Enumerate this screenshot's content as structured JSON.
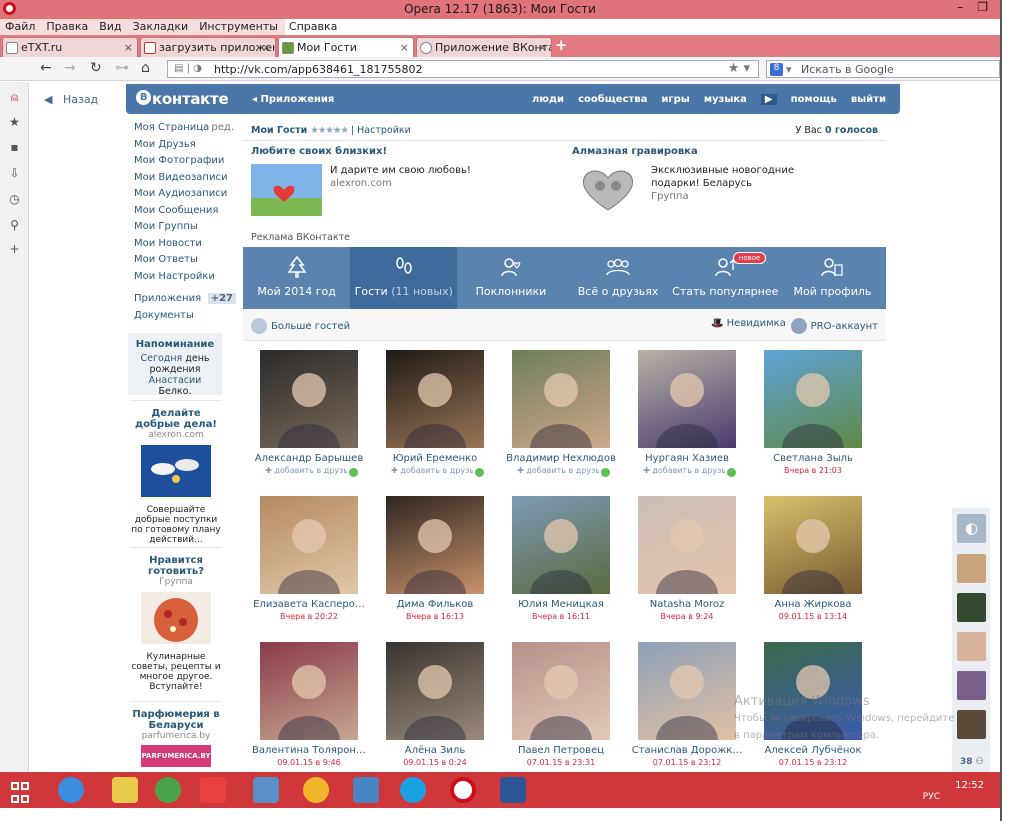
{
  "window": {
    "title": "Opera 12.17 (1863): Мои Гости",
    "menu": [
      "Файл",
      "Правка",
      "Вид",
      "Закладки",
      "Инструменты",
      "Справка"
    ],
    "tabs": [
      {
        "label": "eTXT.ru"
      },
      {
        "label": "загрузить приложени…"
      },
      {
        "label": "Мои Гости"
      },
      {
        "label": "Приложение ВКонтак…"
      }
    ],
    "url": "http://vk.com/app638461_181755802",
    "search_placeholder": "Искать в Google"
  },
  "vk": {
    "back": "Назад",
    "logo": "контакте",
    "apps_link": "Приложения",
    "nav": [
      "люди",
      "сообщества",
      "игры",
      "музыка",
      "помощь",
      "выйти"
    ],
    "left_menu": [
      {
        "label": "Моя Страница",
        "extra": "ред."
      },
      {
        "label": "Мои Друзья"
      },
      {
        "label": "Мои Фотографии"
      },
      {
        "label": "Мои Видеозаписи"
      },
      {
        "label": "Мои Аудиозаписи"
      },
      {
        "label": "Мои Сообщения"
      },
      {
        "label": "Мои Группы"
      },
      {
        "label": "Мои Новости"
      },
      {
        "label": "Мои Ответы"
      },
      {
        "label": "Мои Настройки"
      }
    ],
    "left_menu2": [
      {
        "label": "Приложения",
        "count": "+27"
      },
      {
        "label": "Документы"
      }
    ],
    "reminder": {
      "title": "Напоминание",
      "line1_link": "Сегодня",
      "line1_rest": "день",
      "line2": "рождения",
      "line2_link": "Анастасии",
      "line3": "Белко."
    },
    "side_ads": [
      {
        "title": "Делайте добрые дела!",
        "sub": "alexron.com",
        "text": "Совершайте добрые поступки по готовому плану действий..."
      },
      {
        "title": "Нравится готовить?",
        "sub": "Группа",
        "text": "Кулинарные советы, рецепты и многое другое. Вступайте!"
      },
      {
        "title": "Парфюмерия в Беларуси",
        "sub": "parfumerica.by",
        "text": "PARFUMERICA.BY"
      }
    ]
  },
  "app": {
    "name": "Мои Гости",
    "stars": "★★★★★",
    "settings": "Настройки",
    "votes_prefix": "У Вас",
    "votes_value": "0 голосов",
    "ads": [
      {
        "title": "Любите своих близких!",
        "text": "И дарите им свою любовь!",
        "domain": "alexron.com"
      },
      {
        "title": "Алмазная гравировка",
        "text": "Эксклюзивные новогодние подарки! Беларусь",
        "domain": "Группа"
      }
    ],
    "ad_caption": "Реклама ВКонтакте",
    "tabs": [
      {
        "label": "Мой 2014 год"
      },
      {
        "label": "Гости",
        "extra": "(11 новых)"
      },
      {
        "label": "Поклонники"
      },
      {
        "label": "Всё о друзьях"
      },
      {
        "label": "Стать популярнее",
        "badge": "новое"
      },
      {
        "label": "Мой профиль"
      }
    ],
    "more_guests": "Больше гостей",
    "invisible": "Невидимка",
    "pro": "PRO-аккаунт",
    "guests": [
      {
        "name": "Александр Барышев",
        "sub": "добавить в друзья",
        "kind": "add",
        "online": true,
        "bg": [
          "#2a2a2a",
          "#7a6a5a"
        ]
      },
      {
        "name": "Юрий Еременко",
        "sub": "добавить в друзья",
        "kind": "add",
        "online": true,
        "bg": [
          "#1e1a16",
          "#9b7656"
        ]
      },
      {
        "name": "Владимир Нехлюдов",
        "sub": "добавить в друзья",
        "kind": "add",
        "online": true,
        "bg": [
          "#6d7e5a",
          "#d0a88a"
        ]
      },
      {
        "name": "Нургаян Хазиев",
        "sub": "добавить в друзья",
        "kind": "add",
        "online": true,
        "bg": [
          "#b9b2a6",
          "#4a3a6e"
        ]
      },
      {
        "name": "Светлана Зыль",
        "sub": "Вчера в 21:03",
        "kind": "time",
        "online": false,
        "bg": [
          "#5fa2d8",
          "#5f8a45"
        ]
      },
      {
        "name": "Елизавета Касперо…",
        "sub": "Вчера в 20:22",
        "kind": "time",
        "online": false,
        "bg": [
          "#b58a62",
          "#e2c7a8"
        ]
      },
      {
        "name": "Дима Фильков",
        "sub": "Вчера в 16:13",
        "kind": "time",
        "online": false,
        "bg": [
          "#2f2620",
          "#c9926b"
        ]
      },
      {
        "name": "Юлия Меницкая",
        "sub": "Вчера в 16:11",
        "kind": "time",
        "online": false,
        "bg": [
          "#7b9ab6",
          "#5c6a3e"
        ]
      },
      {
        "name": "Natasha Moroz",
        "sub": "Вчера в 9:24",
        "kind": "time",
        "online": false,
        "bg": [
          "#c9bfb6",
          "#e6c2a8"
        ]
      },
      {
        "name": "Анна Жиркова",
        "sub": "09.01.15 в 13:14",
        "kind": "time",
        "online": false,
        "bg": [
          "#d9c06b",
          "#7a5a32"
        ]
      },
      {
        "name": "Валентина Толярон…",
        "sub": "09.01.15 в 9:46",
        "kind": "time",
        "online": false,
        "bg": [
          "#8a3a4a",
          "#c6a890"
        ]
      },
      {
        "name": "Алёна Зиль",
        "sub": "09.01.15 в 0:24",
        "kind": "time",
        "online": false,
        "bg": [
          "#3a3430",
          "#9a8a7a"
        ]
      },
      {
        "name": "Павел Петровец",
        "sub": "07.01.15 в 23:31",
        "kind": "time",
        "online": false,
        "bg": [
          "#b8908a",
          "#e3c9b8"
        ]
      },
      {
        "name": "Станислав Дорожк…",
        "sub": "07.01.15 в 23:12",
        "kind": "time",
        "online": false,
        "bg": [
          "#8ea0b8",
          "#e0c1a4"
        ]
      },
      {
        "name": "Алексей Лубчёнок",
        "sub": "07.01.15 в 23:12",
        "kind": "time",
        "online": false,
        "bg": [
          "#3a6a4a",
          "#3a5ab0"
        ]
      }
    ]
  },
  "rightbar": {
    "count": "38"
  },
  "watermark": {
    "line1": "Активация Windows",
    "line2": "Чтобы активировать Windows, перейдите",
    "line3": "в параметрам компьютера."
  },
  "taskbar": {
    "clock": "12:52",
    "lang": "РУС"
  }
}
